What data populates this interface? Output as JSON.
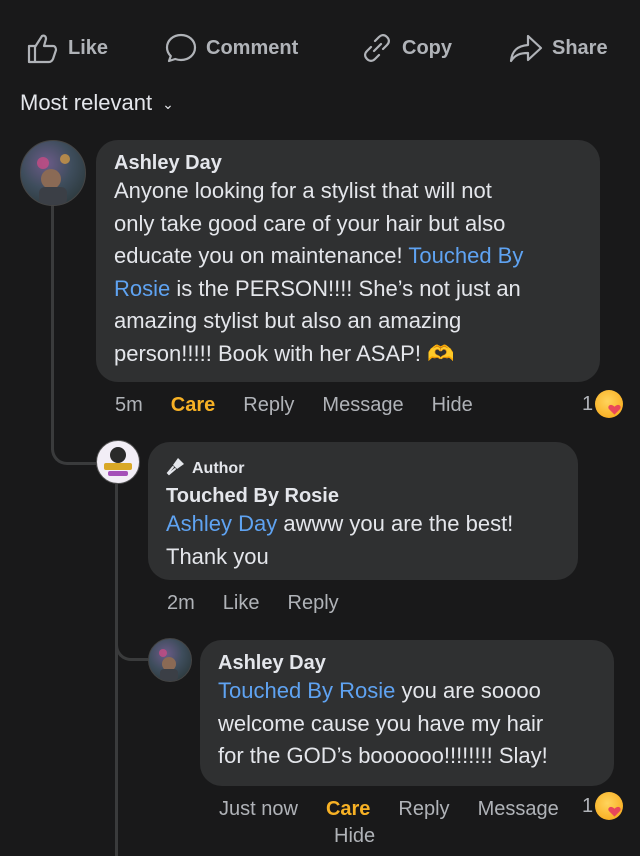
{
  "actions": {
    "like": "Like",
    "comment": "Comment",
    "copy": "Copy",
    "share": "Share"
  },
  "sort": {
    "label": "Most relevant"
  },
  "comments": [
    {
      "author": "Ashley Day",
      "text_lines": [
        "Anyone looking for a stylist that will not",
        "only take good care of your hair but also",
        "educate you on maintenance! ",
        " is the PERSON!!!! She’s not just an",
        "amazing stylist but also an amazing",
        "person!!!!! Book with her ASAP! 🫶"
      ],
      "mention_a": "Touched By",
      "mention_b": "Rosie",
      "time": "5m",
      "care": "Care",
      "reply": "Reply",
      "message": "Message",
      "hide": "Hide",
      "reaction_count": "1"
    },
    {
      "badge": "Author",
      "author": "Touched By Rosie",
      "mention": "Ashley Day",
      "text_line1_rest": " awww you are the best!",
      "text_line2": "Thank you",
      "time": "2m",
      "like": "Like",
      "reply": "Reply"
    },
    {
      "author": "Ashley Day",
      "mention": "Touched By Rosie",
      "text_line1_rest": " you are soooo",
      "text_line2": "welcome cause you have my hair",
      "text_line3": "for the GOD’s boooooo!!!!!!!! Slay!",
      "time": "Just now",
      "care": "Care",
      "reply": "Reply",
      "message": "Message",
      "hide": "Hide",
      "reaction_count": "1"
    }
  ],
  "colors": {
    "background": "#19191a",
    "bubble": "#2f3031",
    "link": "#5fa3f2",
    "care": "#f7b125",
    "meta": "#b0b3b8"
  }
}
